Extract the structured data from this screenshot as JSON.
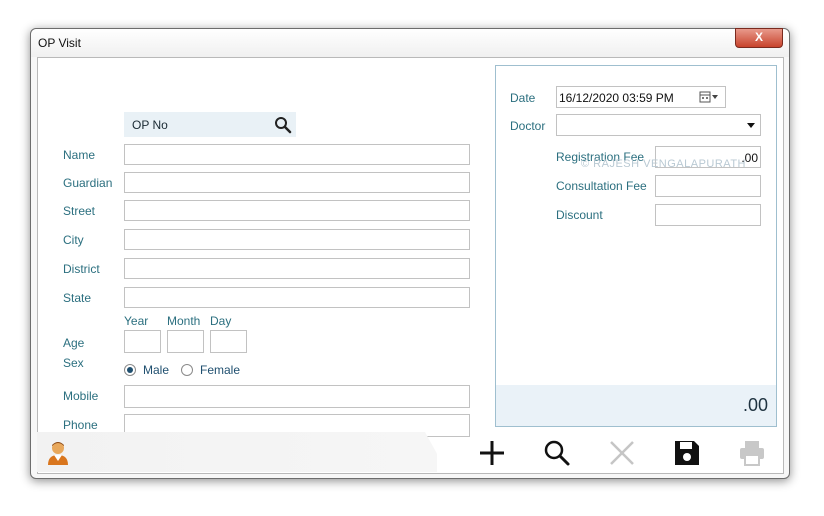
{
  "window": {
    "title": "OP Visit",
    "close_label": "X"
  },
  "left_form": {
    "opno_placeholder": "OP No",
    "labels": {
      "name": "Name",
      "guardian": "Guardian",
      "street": "Street",
      "city": "City",
      "district": "District",
      "state": "State",
      "age": "Age",
      "sex": "Sex",
      "mobile": "Mobile",
      "phone": "Phone"
    },
    "age_headers": {
      "year": "Year",
      "month": "Month",
      "day": "Day"
    },
    "sex_options": [
      {
        "label": "Male",
        "selected": true
      },
      {
        "label": "Female",
        "selected": false
      }
    ]
  },
  "right_panel": {
    "date_label": "Date",
    "date_value": "16/12/2020 03:59 PM",
    "doctor_label": "Doctor",
    "doctor_value": "",
    "registration_fee_label": "Registration Fee",
    "registration_fee_value": ".00",
    "consultation_fee_label": "Consultation Fee",
    "consultation_fee_value": "",
    "discount_label": "Discount",
    "discount_value": "",
    "watermark": "© RAJESH VENGALAPURATH",
    "total": ".00"
  },
  "footer": {
    "icons": [
      "user-icon",
      "add-icon",
      "search-icon",
      "delete-icon",
      "save-icon",
      "print-icon"
    ]
  },
  "colors": {
    "label": "#2b6f7f",
    "panel_border": "#9fbfcf",
    "total_bg": "#eaf2f8",
    "close": "#c8432c"
  }
}
